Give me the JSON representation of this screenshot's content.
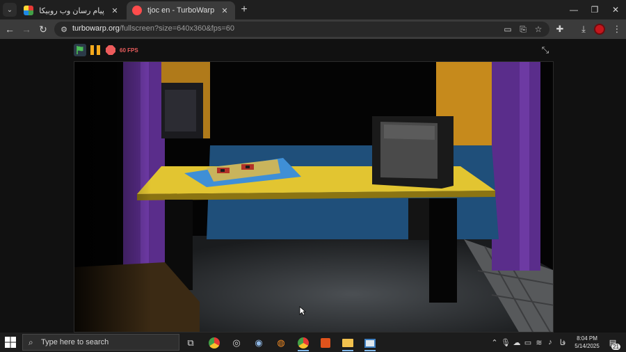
{
  "browser": {
    "tabs": [
      {
        "title": "پیام رسان وب روبیکا",
        "active": false
      },
      {
        "title": "tjoc en - TurboWarp",
        "active": true
      }
    ],
    "url_host": "turbowarp.org",
    "url_path": "/fullscreen?size=640x360&fps=60"
  },
  "player": {
    "fps_label": "60 FPS"
  },
  "taskbar": {
    "search_placeholder": "Type here to search",
    "time": "8:04 PM",
    "date": "5/14/2025",
    "language": "فا",
    "notification_count": "21"
  },
  "colors": {
    "accent_turbowarp": "#ff4c4c",
    "flag_green": "#4cbf56",
    "pause_yellow": "#f5a91c",
    "stop_red": "#ec5b5b"
  }
}
